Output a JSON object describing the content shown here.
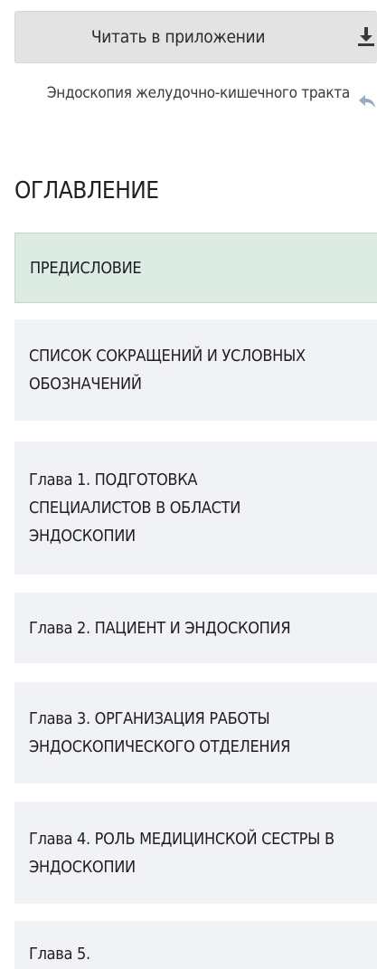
{
  "app_button": {
    "label": "Читать в приложении",
    "icon": "download-icon"
  },
  "book": {
    "title": "Эндоскопия желудочно-кишечного тракта",
    "back_icon": "back-arrow-icon"
  },
  "toc": {
    "heading": "ОГЛАВЛЕНИЕ",
    "items": [
      {
        "label": "ПРЕДИСЛОВИЕ",
        "active": true
      },
      {
        "label": "СПИСОК СОКРАЩЕНИЙ И УСЛОВНЫХ ОБОЗНАЧЕНИЙ",
        "active": false
      },
      {
        "label": "Глава 1. ПОДГОТОВКА СПЕЦИАЛИСТОВ В ОБЛАСТИ ЭНДОСКОПИИ",
        "active": false
      },
      {
        "label": "Глава 2. ПАЦИЕНТ И ЭНДОСКОПИЯ",
        "active": false
      },
      {
        "label": "Глава 3. ОРГАНИЗАЦИЯ РАБОТЫ ЭНДОСКОПИЧЕСКОГО ОТДЕЛЕНИЯ",
        "active": false
      },
      {
        "label": "Глава 4. РОЛЬ МЕДИЦИНСКОЙ СЕСТРЫ В ЭНДОСКОПИИ",
        "active": false
      },
      {
        "label": "Глава 5.",
        "active": false
      }
    ]
  },
  "colors": {
    "active_item_bg": "#dcebe4",
    "item_bg": "#f1f2f5",
    "button_bg": "#e3e3e3"
  }
}
